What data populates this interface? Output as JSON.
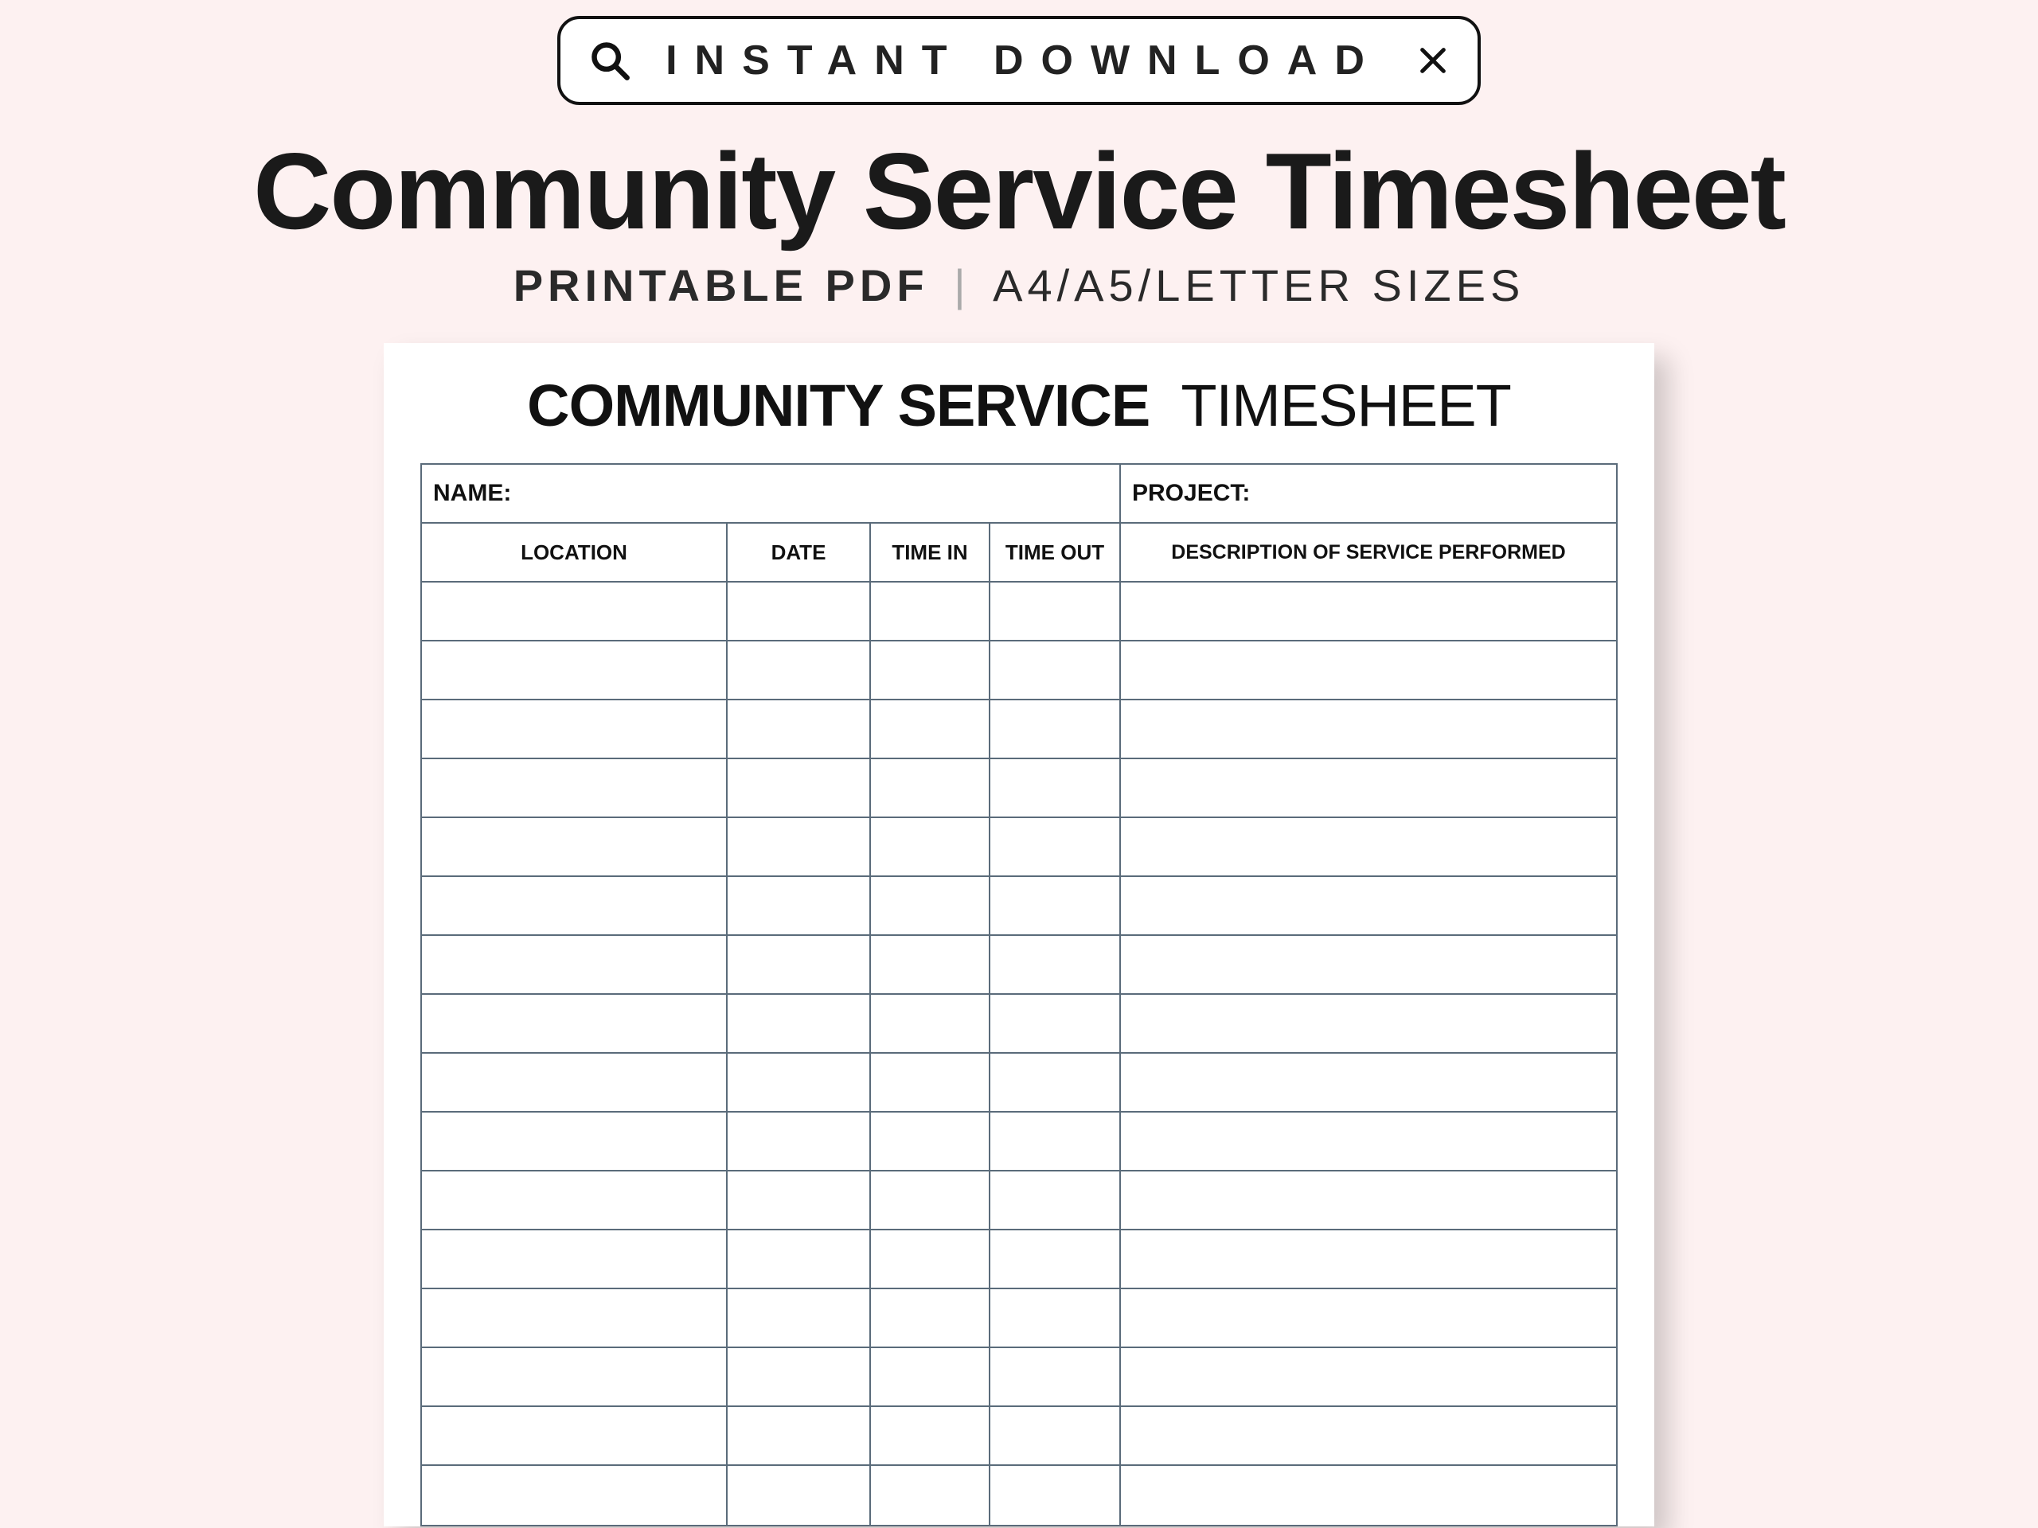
{
  "search": {
    "text": "INSTANT DOWNLOAD"
  },
  "headline": "Community Service Timesheet",
  "subhead": {
    "bold": "PRINTABLE PDF",
    "sep": "|",
    "rest": "A4/A5/LETTER SIZES"
  },
  "sheet": {
    "title_heavy": "COMMUNITY SERVICE",
    "title_light": "TIMESHEET",
    "meta": {
      "name_label": "NAME:",
      "project_label": "PROJECT:"
    },
    "columns": {
      "location": "LOCATION",
      "date": "DATE",
      "time_in": "TIME IN",
      "time_out": "TIME OUT",
      "description": "DESCRIPTION OF SERVICE PERFORMED"
    },
    "blank_row_count": 16
  }
}
